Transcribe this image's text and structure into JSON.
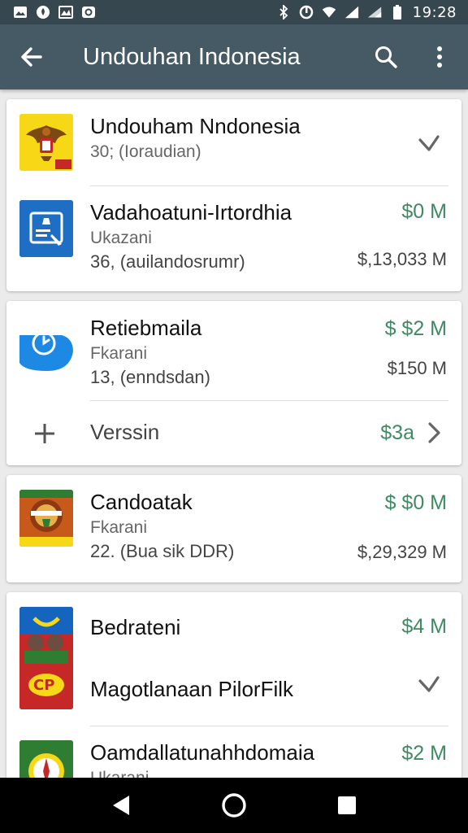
{
  "status_bar": {
    "time": "19:28",
    "left_icons": [
      "gallery-icon",
      "notification-icon",
      "photo-icon",
      "app-icon"
    ],
    "right_icons": [
      "bluetooth-icon",
      "alarm-icon",
      "wifi-icon",
      "signal-icon",
      "battery-icon"
    ]
  },
  "appbar": {
    "title": "Undouhan Indonesia",
    "back_icon": "arrow-left-icon",
    "search_icon": "search-icon",
    "menu_icon": "more-vert-icon"
  },
  "colors": {
    "statusbar": "#37474f",
    "appbar": "#455a64",
    "accent_green": "#3f8a63",
    "background": "#ebebeb"
  },
  "cards": [
    {
      "rows": [
        {
          "name": "Undouham Nndonesia",
          "sub": "30; (Ioraudian)",
          "icon": "garuda-emblem-icon",
          "trailing": "chevron-right-icon"
        },
        {
          "name": "Vadahoatuni-Irtordhia",
          "sub": "Ukazani",
          "sub2": "36, (auilandosrumr)",
          "icon": "document-edit-icon",
          "price_top": "$0 M",
          "price_bottom": "$,13,033 M"
        }
      ]
    },
    {
      "rows": [
        {
          "name": "Retiebmaila",
          "sub": "Fkarani",
          "sub2": "13, (enndsdan)",
          "icon": "clock-icon",
          "price_top": "$ $2 M",
          "price_bottom": "$150 M"
        },
        {
          "name": "Verssin",
          "icon": "plus-icon",
          "price_top": "$3a",
          "trailing": "chevron-right-icon"
        }
      ]
    },
    {
      "rows": [
        {
          "name": "Candoatak",
          "sub": "Fkarani",
          "sub2": "22. (Bua sik DDR)",
          "icon": "food-poster-icon",
          "price_top": "$ $0 M",
          "price_bottom": "$,29,329 M"
        }
      ]
    },
    {
      "rows": [
        {
          "name": "Bedrateni",
          "icon": "movie-poster-icon",
          "price_top": "$4 M"
        },
        {
          "name": "Magotlanaan PilorFilk",
          "trailing": "chevron-right-icon"
        },
        {
          "name": "Oamdallatunahhdomaia",
          "sub": "Ukarani",
          "icon": "compass-icon",
          "price_top": "$2 M"
        }
      ]
    }
  ],
  "nav": {
    "back": "nav-back-icon",
    "home": "nav-home-icon",
    "recents": "nav-recents-icon"
  }
}
